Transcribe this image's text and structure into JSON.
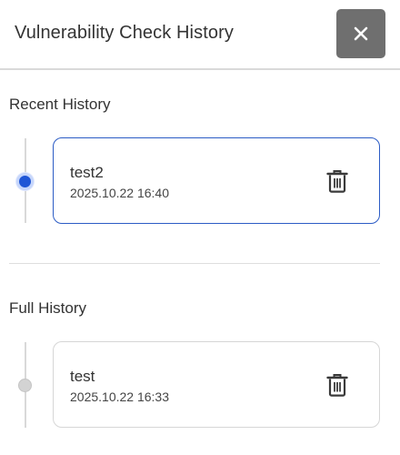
{
  "header": {
    "title": "Vulnerability Check History",
    "close_icon": "close-icon"
  },
  "recent": {
    "title": "Recent History",
    "items": [
      {
        "name": "test2",
        "date": "2025.10.22 16:40",
        "selected": true,
        "icon": "trash-icon"
      }
    ]
  },
  "full": {
    "title": "Full History",
    "items": [
      {
        "name": "test",
        "date": "2025.10.22 16:33",
        "selected": false,
        "icon": "trash-icon"
      }
    ]
  },
  "colors": {
    "accent": "#1f56d6",
    "card_border_active": "#2c5cc5",
    "close_button_bg": "#6f6f6f"
  }
}
